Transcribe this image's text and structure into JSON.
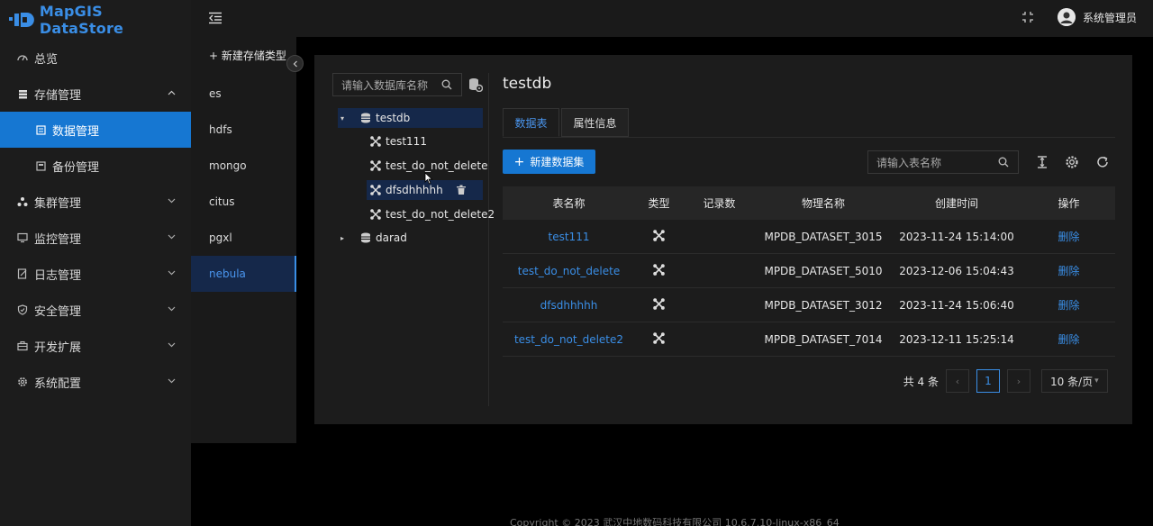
{
  "app": {
    "name": "MapGIS DataStore"
  },
  "sidebar": {
    "items": [
      {
        "label": "总览",
        "icon": "dashboard-icon"
      },
      {
        "label": "存储管理",
        "icon": "storage-icon",
        "expanded": true
      },
      {
        "label": "数据管理",
        "icon": "data-icon",
        "active": true
      },
      {
        "label": "备份管理",
        "icon": "backup-icon"
      },
      {
        "label": "集群管理",
        "icon": "cluster-icon"
      },
      {
        "label": "监控管理",
        "icon": "monitor-icon"
      },
      {
        "label": "日志管理",
        "icon": "log-icon"
      },
      {
        "label": "安全管理",
        "icon": "shield-icon"
      },
      {
        "label": "开发扩展",
        "icon": "toolbox-icon"
      },
      {
        "label": "系统配置",
        "icon": "gear-icon"
      }
    ]
  },
  "header": {
    "user": "系统管理员"
  },
  "types": {
    "new_label": "+ 新建存储类型",
    "items": [
      "es",
      "hdfs",
      "mongo",
      "citus",
      "pgxl",
      "nebula"
    ],
    "active": "nebula"
  },
  "db_panel": {
    "search_placeholder": "请输入数据库名称",
    "tree": {
      "db1": "testdb",
      "children": [
        "test111",
        "test_do_not_delete",
        "dfsdhhhhh",
        "test_do_not_delete2"
      ],
      "db2": "darad"
    }
  },
  "main": {
    "title": "testdb",
    "tabs": [
      "数据表",
      "属性信息"
    ],
    "new_button": "新建数据集",
    "table_search_placeholder": "请输入表名称",
    "columns": [
      "表名称",
      "类型",
      "记录数",
      "物理名称",
      "创建时间",
      "操作"
    ],
    "rows": [
      {
        "name": "test111",
        "records": "",
        "physical": "MPDB_DATASET_3015",
        "created": "2023-11-24 15:14:00",
        "action": "删除"
      },
      {
        "name": "test_do_not_delete",
        "records": "",
        "physical": "MPDB_DATASET_5010",
        "created": "2023-12-06 15:04:43",
        "action": "删除"
      },
      {
        "name": "dfsdhhhhh",
        "records": "",
        "physical": "MPDB_DATASET_3012",
        "created": "2023-11-24 15:06:40",
        "action": "删除"
      },
      {
        "name": "test_do_not_delete2",
        "records": "",
        "physical": "MPDB_DATASET_7014",
        "created": "2023-12-11 15:25:14",
        "action": "删除"
      }
    ],
    "pagination": {
      "total": "共 4 条",
      "page": "1",
      "page_size": "10 条/页"
    }
  },
  "footer": {
    "text": "Copyright © 2023 武汉中地数码科技有限公司 10.6.7.10-linux-x86_64"
  },
  "colors": {
    "accent": "#1677d2",
    "link": "#3a8ee6",
    "bg": "#000000",
    "panel": "#1c1c1c"
  }
}
